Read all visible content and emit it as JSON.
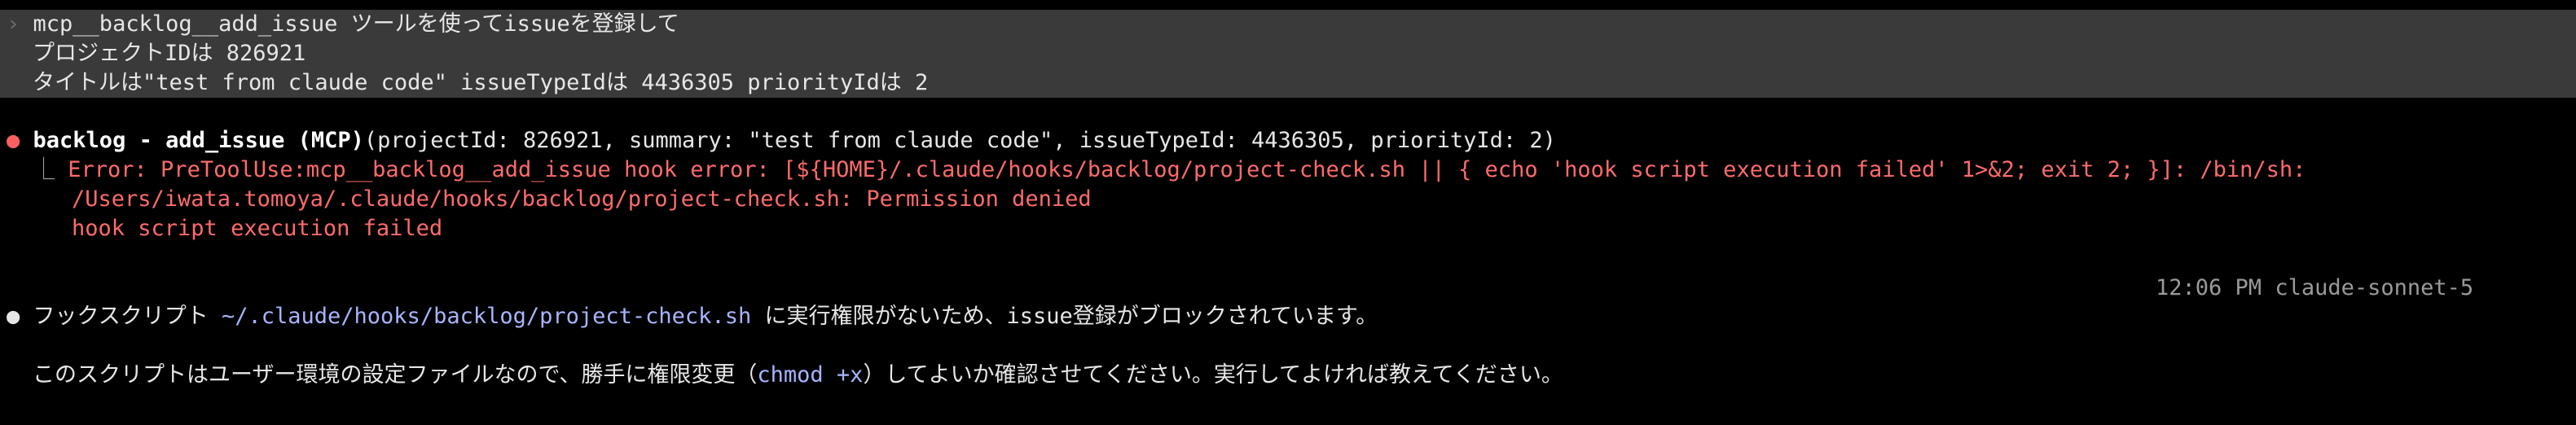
{
  "prompt": {
    "chevron": "›",
    "line1": "mcp__backlog__add_issue ツールを使ってissueを登録して",
    "line2": "プロジェクトIDは 826921",
    "line3": "タイトルは\"test from claude code\" issueTypeIdは 4436305 priorityIdは 2"
  },
  "tool_call": {
    "bullet": "●",
    "name": "backlog - add_issue (MCP)",
    "args": "(projectId: 826921, summary: \"test from claude code\", issueTypeId: 4436305, priorityId: 2)",
    "tree": "⎿",
    "error_line1": "Error: PreToolUse:mcp__backlog__add_issue hook error: [${HOME}/.claude/hooks/backlog/project-check.sh || { echo 'hook script execution failed' 1>&2; exit 2; }]: /bin/sh:",
    "error_line2": "/Users/iwata.tomoya/.claude/hooks/backlog/project-check.sh: Permission denied",
    "error_line3": "hook script execution failed"
  },
  "meta": {
    "time": "12:06 PM",
    "model": "claude-sonnet-5"
  },
  "response": {
    "bullet": "●",
    "part1": "フックスクリプト ",
    "path": "~/.claude/hooks/backlog/project-check.sh",
    "part2": " に実行権限がないため、issue登録がブロックされています。",
    "line2_part1": "このスクリプトはユーザー環境の設定ファイルなので、勝手に権限変更（",
    "line2_cmd": "chmod +x",
    "line2_part2": "）してよいか確認させてください。実行してよければ教えてください。"
  },
  "colors": {
    "error": "#ff6b6b",
    "path": "#a8b4ff",
    "prompt_bg": "#3a3a3a"
  }
}
